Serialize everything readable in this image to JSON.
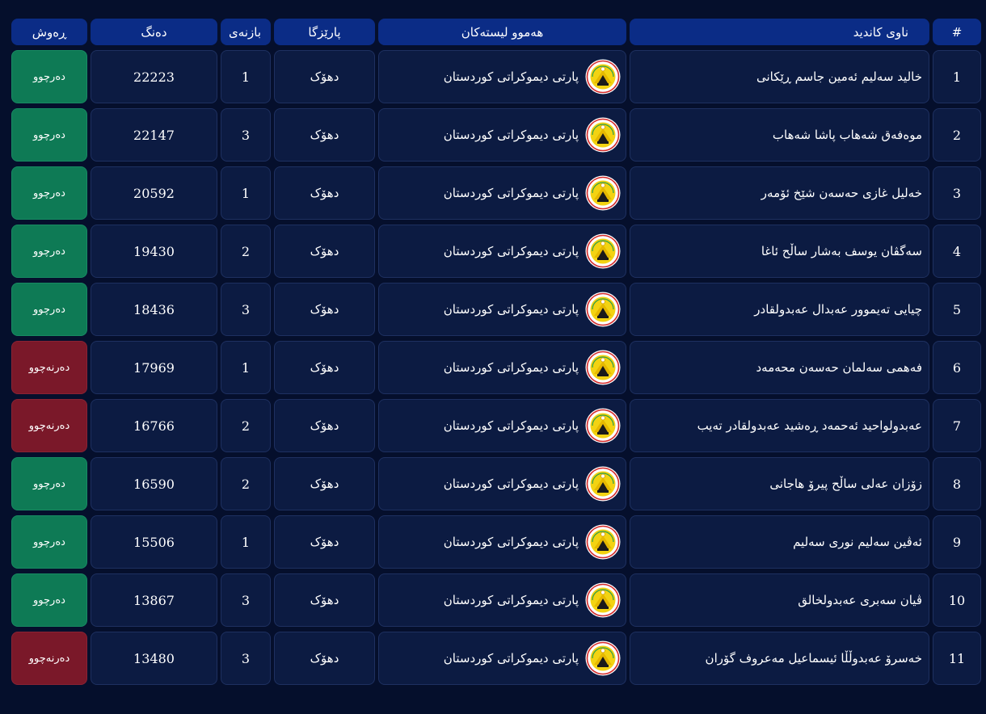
{
  "headers": {
    "num": "#",
    "name": "ناوی کاندید",
    "list": "هەموو لیستەکان",
    "province": "پارێزگا",
    "seat": "بازنەی",
    "votes": "دەنگ",
    "status": "ڕەوش"
  },
  "party_logo_icon": "kdp-logo-icon",
  "colors": {
    "header_bg": "#0b2c86",
    "win": "#0e7a55",
    "lose": "#7a1829",
    "page_bg": "#050f2c"
  },
  "rows": [
    {
      "num": "1",
      "name": "خالید سەلیم ئەمین جاسم ڕێکانی",
      "list": "پارتی دیموکراتی کوردستان",
      "province": "دهۆک",
      "seat": "1",
      "votes": "22223",
      "status": "دەرچوو",
      "won": true
    },
    {
      "num": "2",
      "name": "موەفەق شەهاب پاشا شەهاب",
      "list": "پارتی دیموکراتی کوردستان",
      "province": "دهۆک",
      "seat": "3",
      "votes": "22147",
      "status": "دەرچوو",
      "won": true
    },
    {
      "num": "3",
      "name": "خەلیل غازی حەسەن شێخ ئۆمەر",
      "list": "پارتی دیموکراتی کوردستان",
      "province": "دهۆک",
      "seat": "1",
      "votes": "20592",
      "status": "دەرچوو",
      "won": true
    },
    {
      "num": "4",
      "name": "سەگڤان یوسف بەشار ساڵح ئاغا",
      "list": "پارتی دیموکراتی کوردستان",
      "province": "دهۆک",
      "seat": "2",
      "votes": "19430",
      "status": "دەرچوو",
      "won": true
    },
    {
      "num": "5",
      "name": "چیایی تەیموور عەبدال عەبدولقادر",
      "list": "پارتی دیموکراتی کوردستان",
      "province": "دهۆک",
      "seat": "3",
      "votes": "18436",
      "status": "دەرچوو",
      "won": true
    },
    {
      "num": "6",
      "name": "فەهمی سەلمان حەسەن محەمەد",
      "list": "پارتی دیموکراتی کوردستان",
      "province": "دهۆک",
      "seat": "1",
      "votes": "17969",
      "status": "دەرنەچوو",
      "won": false
    },
    {
      "num": "7",
      "name": "عەبدولواحید ئەحمەد ڕەشید عەبدولقادر تەیب",
      "list": "پارتی دیموکراتی کوردستان",
      "province": "دهۆک",
      "seat": "2",
      "votes": "16766",
      "status": "دەرنەچوو",
      "won": false
    },
    {
      "num": "8",
      "name": "زۆزان عەلی ساڵح پیرۆ هاجانی",
      "list": "پارتی دیموکراتی کوردستان",
      "province": "دهۆک",
      "seat": "2",
      "votes": "16590",
      "status": "دەرچوو",
      "won": true
    },
    {
      "num": "9",
      "name": "ئەڤین سەلیم نوری سەلیم",
      "list": "پارتی دیموکراتی کوردستان",
      "province": "دهۆک",
      "seat": "1",
      "votes": "15506",
      "status": "دەرچوو",
      "won": true
    },
    {
      "num": "10",
      "name": "ڤیان سەبری عەبدولخالق",
      "list": "پارتی دیموکراتی کوردستان",
      "province": "دهۆک",
      "seat": "3",
      "votes": "13867",
      "status": "دەرچوو",
      "won": true
    },
    {
      "num": "11",
      "name": "خەسرۆ عەبدوڵڵا ئیسماعیل مەعروف گۆران",
      "list": "پارتی دیموکراتی کوردستان",
      "province": "دهۆک",
      "seat": "3",
      "votes": "13480",
      "status": "دەرنەچوو",
      "won": false
    }
  ]
}
